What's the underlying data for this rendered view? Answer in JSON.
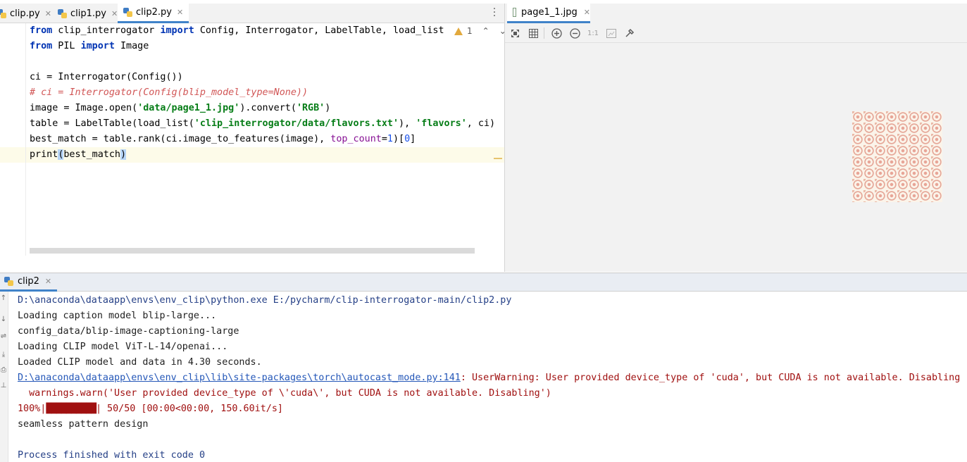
{
  "editor": {
    "tabs": [
      {
        "label": "clip.py",
        "active": false
      },
      {
        "label": "clip1.py",
        "active": false
      },
      {
        "label": "clip2.py",
        "active": true
      }
    ],
    "inspection": {
      "warning_count": "1"
    },
    "code_lines": [
      [
        {
          "t": "from",
          "c": "kw"
        },
        {
          "t": " clip_interrogator ",
          "c": ""
        },
        {
          "t": "import",
          "c": "kw"
        },
        {
          "t": " Config, Interrogator, LabelTable, load_list",
          "c": ""
        }
      ],
      [
        {
          "t": "from",
          "c": "kw"
        },
        {
          "t": " PIL ",
          "c": ""
        },
        {
          "t": "import",
          "c": "kw"
        },
        {
          "t": " Image",
          "c": ""
        }
      ],
      [],
      [
        {
          "t": "ci = Interrogator(Config())",
          "c": ""
        }
      ],
      [
        {
          "t": "# ci = Interrogator(Config(blip_model_type=None))",
          "c": "cmt"
        }
      ],
      [
        {
          "t": "image = Image.open(",
          "c": ""
        },
        {
          "t": "'data/page1_1.jpg'",
          "c": "str"
        },
        {
          "t": ").convert(",
          "c": ""
        },
        {
          "t": "'RGB'",
          "c": "str"
        },
        {
          "t": ")",
          "c": ""
        }
      ],
      [
        {
          "t": "table = LabelTable(load_list(",
          "c": ""
        },
        {
          "t": "'clip_interrogator/data/flavors.txt'",
          "c": "str"
        },
        {
          "t": "), ",
          "c": ""
        },
        {
          "t": "'flavors'",
          "c": "str"
        },
        {
          "t": ", ci)",
          "c": ""
        }
      ],
      [
        {
          "t": "best_match = table.rank(ci.image_to_features(image), ",
          "c": ""
        },
        {
          "t": "top_count",
          "c": "param"
        },
        {
          "t": "=",
          "c": ""
        },
        {
          "t": "1",
          "c": "num"
        },
        {
          "t": ")[",
          "c": ""
        },
        {
          "t": "0",
          "c": "num"
        },
        {
          "t": "]",
          "c": ""
        }
      ],
      [
        {
          "t": "print",
          "c": ""
        },
        {
          "t": "(",
          "c": "paren-hl"
        },
        {
          "t": "best_match",
          "c": ""
        },
        {
          "t": ")",
          "c": "paren-hl"
        }
      ]
    ]
  },
  "viewer": {
    "tab_label": "page1_1.jpg",
    "toolbar": {
      "fit_icon": "fit-screen-icon",
      "grid_icon": "grid-icon",
      "zoom_in_icon": "zoom-in-icon",
      "zoom_out_icon": "zoom-out-icon",
      "actual_size_label": "1:1",
      "background_icon": "background-icon",
      "color_picker_icon": "eyedropper-icon"
    }
  },
  "run": {
    "tab_label": "clip2",
    "output": [
      {
        "t": "D:\\anaconda\\dataapp\\envs\\env_clip\\python.exe E:/pycharm/clip-interrogator-main/clip2.py",
        "style": "path"
      },
      {
        "t": "Loading caption model blip-large...",
        "style": "plain"
      },
      {
        "t": "config_data/blip-image-captioning-large",
        "style": "plain"
      },
      {
        "t": "Loading CLIP model ViT-L-14/openai...",
        "style": "plain"
      },
      {
        "t": "Loaded CLIP model and data in 4.30 seconds.",
        "style": "plain"
      },
      {
        "t": "D:\\anaconda\\dataapp\\envs\\env_clip\\lib\\site-packages\\torch\\autocast_mode.py:141",
        "style": "warnlink",
        "rest": ": UserWarning: User provided device_type of 'cuda', but CUDA is not available. Disabling"
      },
      {
        "t": "  warnings.warn('User provided device_type of \\'cuda\\', but CUDA is not available. Disabling')",
        "style": "err"
      },
      {
        "t": "100%|",
        "style": "progress",
        "bar": "██████████",
        "rest": "| 50/50 [00:00<00:00, 150.60it/s]"
      },
      {
        "t": "seamless pattern design",
        "style": "plain"
      },
      {
        "t": "",
        "style": "plain"
      },
      {
        "t": "Process finished with exit code 0",
        "style": "path"
      }
    ]
  }
}
